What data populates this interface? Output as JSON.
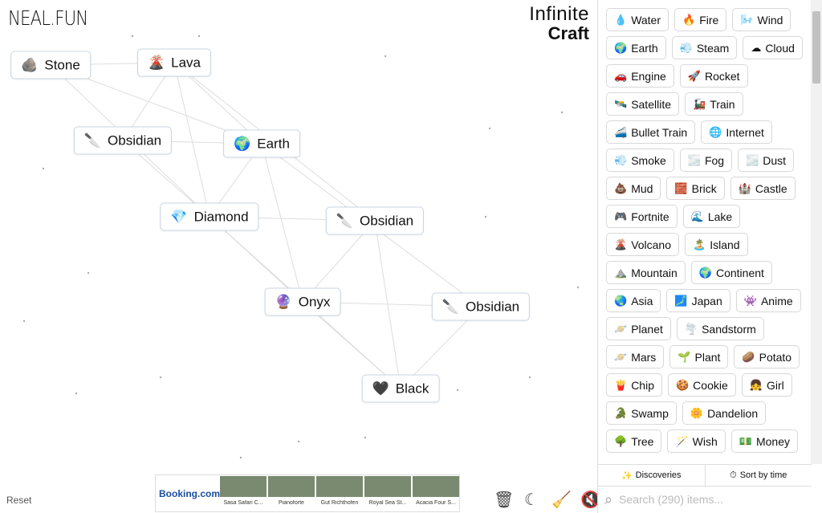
{
  "logo": "NEAL.FUN",
  "title": {
    "line1": "Infinite",
    "line2": "Craft"
  },
  "canvas_nodes": [
    {
      "label": "Stone",
      "icon": "🪨"
    },
    {
      "label": "Lava",
      "icon": "🌋"
    },
    {
      "label": "Obsidian",
      "icon": "🔪"
    },
    {
      "label": "Earth",
      "icon": "🌍"
    },
    {
      "label": "Diamond",
      "icon": "💎"
    },
    {
      "label": "Obsidian",
      "icon": "🔪"
    },
    {
      "label": "Onyx",
      "icon": "🔮"
    },
    {
      "label": "Obsidian",
      "icon": "🔪"
    },
    {
      "label": "Black",
      "icon": "🖤"
    }
  ],
  "reset": "Reset",
  "ad": {
    "brand": "Booking.com",
    "tiles": [
      "Sasa Safari C...",
      "Pianoforte",
      "Gut Richthofen",
      "Royal Sea St...",
      "Acacia Four S..."
    ]
  },
  "tools": {
    "trash": "🗑",
    "moon": "☾",
    "broom": "🧹",
    "mute": "🔇"
  },
  "items_rows": [
    [
      {
        "label": "Water",
        "icon": "💧"
      },
      {
        "label": "Fire",
        "icon": "🔥"
      },
      {
        "label": "Wind",
        "icon": "🌬️"
      }
    ],
    [
      {
        "label": "Earth",
        "icon": "🌍"
      },
      {
        "label": "Steam",
        "icon": "💨"
      },
      {
        "label": "Cloud",
        "icon": "☁"
      }
    ],
    [
      {
        "label": "Engine",
        "icon": "🚗"
      },
      {
        "label": "Rocket",
        "icon": "🚀"
      }
    ],
    [
      {
        "label": "Satellite",
        "icon": "🛰️"
      },
      {
        "label": "Train",
        "icon": "🚂"
      }
    ],
    [
      {
        "label": "Bullet Train",
        "icon": "🚄"
      },
      {
        "label": "Internet",
        "icon": "🌐"
      }
    ],
    [
      {
        "label": "Smoke",
        "icon": "💨"
      },
      {
        "label": "Fog",
        "icon": "🌫️"
      },
      {
        "label": "Dust",
        "icon": "🌫️"
      }
    ],
    [
      {
        "label": "Mud",
        "icon": "💩"
      },
      {
        "label": "Brick",
        "icon": "🧱"
      },
      {
        "label": "Castle",
        "icon": "🏰"
      }
    ],
    [
      {
        "label": "Fortnite",
        "icon": "🎮"
      },
      {
        "label": "Lake",
        "icon": "🌊"
      }
    ],
    [
      {
        "label": "Volcano",
        "icon": "🌋"
      },
      {
        "label": "Island",
        "icon": "🏝️"
      }
    ],
    [
      {
        "label": "Mountain",
        "icon": "⛰️"
      },
      {
        "label": "Continent",
        "icon": "🌍"
      }
    ],
    [
      {
        "label": "Asia",
        "icon": "🌏"
      },
      {
        "label": "Japan",
        "icon": "🗾"
      },
      {
        "label": "Anime",
        "icon": "👾"
      }
    ],
    [
      {
        "label": "Planet",
        "icon": "🪐"
      },
      {
        "label": "Sandstorm",
        "icon": "🌪️"
      }
    ],
    [
      {
        "label": "Mars",
        "icon": "🪐"
      },
      {
        "label": "Plant",
        "icon": "🌱"
      },
      {
        "label": "Potato",
        "icon": "🥔"
      }
    ],
    [
      {
        "label": "Chip",
        "icon": "🍟"
      },
      {
        "label": "Cookie",
        "icon": "🍪"
      },
      {
        "label": "Girl",
        "icon": "👧"
      }
    ],
    [
      {
        "label": "Swamp",
        "icon": "🐊"
      },
      {
        "label": "Dandelion",
        "icon": "🌼"
      }
    ],
    [
      {
        "label": "Tree",
        "icon": "🌳"
      },
      {
        "label": "Wish",
        "icon": "🪄"
      },
      {
        "label": "Money",
        "icon": "💵"
      }
    ]
  ],
  "sidebar_bar": {
    "discoveries": "Discoveries",
    "sort": "Sort by time"
  },
  "search": {
    "placeholder": "Search (290) items..."
  }
}
